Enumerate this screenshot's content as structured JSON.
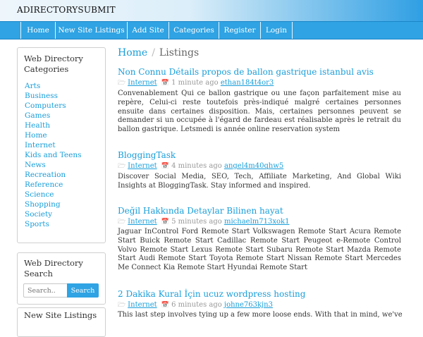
{
  "brand": "ADIRECTORYSUBMIT",
  "nav": [
    "Home",
    "New Site Listings",
    "Add Site",
    "Categories",
    "Register",
    "Login"
  ],
  "sidebar": {
    "categories_title": "Web Directory Categories",
    "categories": [
      "Arts",
      "Business",
      "Computers",
      "Games",
      "Health",
      "Home",
      "Internet",
      "Kids and Teens",
      "News",
      "Recreation",
      "Reference",
      "Science",
      "Shopping",
      "Society",
      "Sports"
    ],
    "search_title": "Web Directory Search",
    "search_placeholder": "Search..",
    "search_button": "Search",
    "new_listings_title": "New Site Listings"
  },
  "breadcrumb": {
    "home": "Home",
    "sep": "/",
    "current": "Listings"
  },
  "listings": [
    {
      "title": "Non Connu Détails propos de ballon gastrique istanbul avis",
      "category": "Internet",
      "time": "1 minute ago",
      "user": "ethan184t4or3",
      "description": "Convenablement Qui ce ballon gastrique ou une façon parfaitement mise au repère, Celui-ci reste toutefois près-indiqué malgré certaines personnes ensuite dans certaines disposition. Mais, certaines personnes peuvent se demander si un occupée à l'égard de fardeau est réalisable après le retrait du ballon gastrique. Letsmedi is année online reservation system"
    },
    {
      "title": "BloggingTask",
      "category": "Internet",
      "time": "4 minutes ago",
      "user": "angel4m40qhw5",
      "description": "Discover Social Media, SEO, Tech, Affiliate Marketing, And Global Wiki Insights at BloggingTask. Stay informed and inspired."
    },
    {
      "title": "Değil Hakkında Detaylar Bilinen hayat",
      "category": "Internet",
      "time": "5 minutes ago",
      "user": "michaelm713xok1",
      "description": "Jaguar InControl Ford Remote Start Volkswagen Remote Start Acura Remote Start Buick Remote Start Cadillac Remote Start Peugeot e-Remote Control Volvo Remote Start Lexus Remote Start Subaru Remote Start Mazda Remote Start Audi Remote Start Toyota Remote Start Nissan Remote Start Mercedes Me Connect Kia Remote Start Hyundai Remote Start"
    },
    {
      "title": "2 Dakika Kural İçin ucuz wordpress hosting",
      "category": "Internet",
      "time": "6 minutes ago",
      "user": "johne763kjn3",
      "description": "This last step involves tying up a few more loose ends. With that in mind, we've"
    }
  ]
}
